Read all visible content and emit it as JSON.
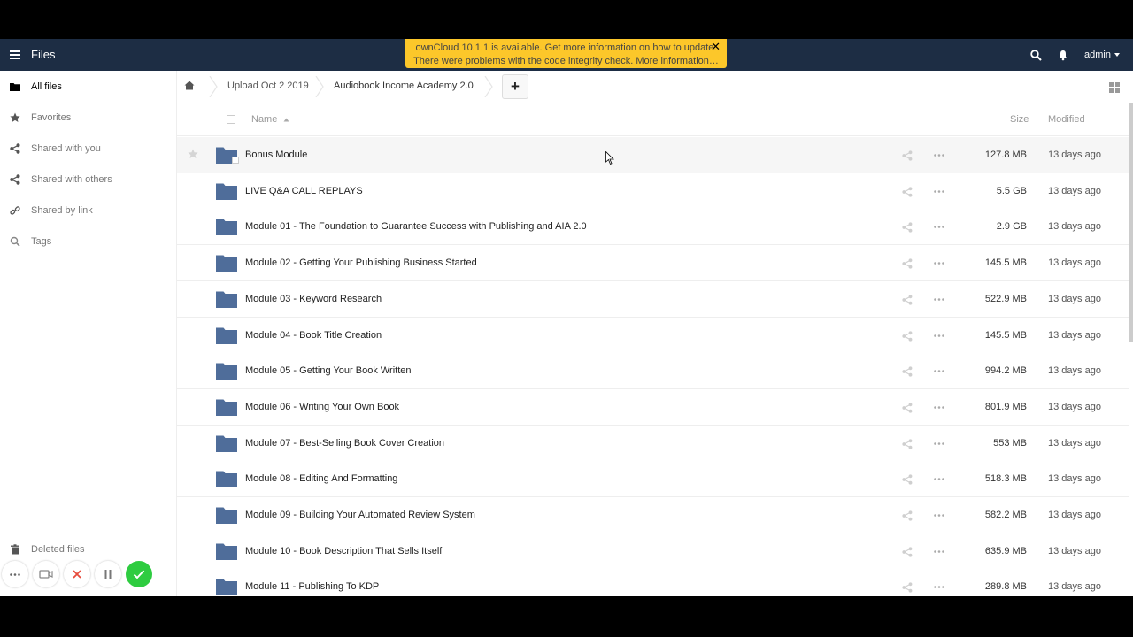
{
  "header": {
    "app_title": "Files",
    "user": "admin"
  },
  "notification": {
    "line1": "ownCloud 10.1.1 is available. Get more information on how to update.",
    "line2": "There were problems with the code integrity check. More information…",
    "close": "✕"
  },
  "sidebar": {
    "items": [
      {
        "label": "All files",
        "icon": "folder-icon"
      },
      {
        "label": "Favorites",
        "icon": "star-icon"
      },
      {
        "label": "Shared with you",
        "icon": "share-icon"
      },
      {
        "label": "Shared with others",
        "icon": "share-icon"
      },
      {
        "label": "Shared by link",
        "icon": "link-icon"
      },
      {
        "label": "Tags",
        "icon": "tag-search-icon"
      }
    ],
    "deleted": "Deleted files"
  },
  "breadcrumb": {
    "items": [
      "Upload Oct 2 2019",
      "Audiobook Income Academy 2.0"
    ],
    "add": "+"
  },
  "table": {
    "columns": {
      "name": "Name",
      "size": "Size",
      "modified": "Modified"
    },
    "rows": [
      {
        "name": "Bonus Module",
        "size": "127.8 MB",
        "modified": "13 days ago"
      },
      {
        "name": "LIVE Q&A CALL REPLAYS",
        "size": "5.5 GB",
        "modified": "13 days ago"
      },
      {
        "name": "Module 01 - The Foundation to Guarantee Success with Publishing and AIA 2.0",
        "size": "2.9 GB",
        "modified": "13 days ago"
      },
      {
        "name": "Module 02 - Getting Your Publishing Business Started",
        "size": "145.5 MB",
        "modified": "13 days ago"
      },
      {
        "name": "Module 03 - Keyword Research",
        "size": "522.9 MB",
        "modified": "13 days ago"
      },
      {
        "name": "Module 04 - Book Title Creation",
        "size": "145.5 MB",
        "modified": "13 days ago"
      },
      {
        "name": "Module 05 - Getting Your Book Written",
        "size": "994.2 MB",
        "modified": "13 days ago"
      },
      {
        "name": "Module 06 - Writing Your Own Book",
        "size": "801.9 MB",
        "modified": "13 days ago"
      },
      {
        "name": "Module 07 - Best-Selling Book Cover Creation",
        "size": "553 MB",
        "modified": "13 days ago"
      },
      {
        "name": "Module 08 - Editing And Formatting",
        "size": "518.3 MB",
        "modified": "13 days ago"
      },
      {
        "name": "Module 09 - Building Your Automated Review System",
        "size": "582.2 MB",
        "modified": "13 days ago"
      },
      {
        "name": "Module 10 - Book Description That Sells Itself",
        "size": "635.9 MB",
        "modified": "13 days ago"
      },
      {
        "name": "Module 11 - Publishing To KDP",
        "size": "289.8 MB",
        "modified": "13 days ago"
      }
    ]
  },
  "colors": {
    "header_bg": "#1d2d44",
    "notice_bg": "#fcc72a",
    "folder": "#4f6d9a",
    "check": "#2ecc40"
  }
}
